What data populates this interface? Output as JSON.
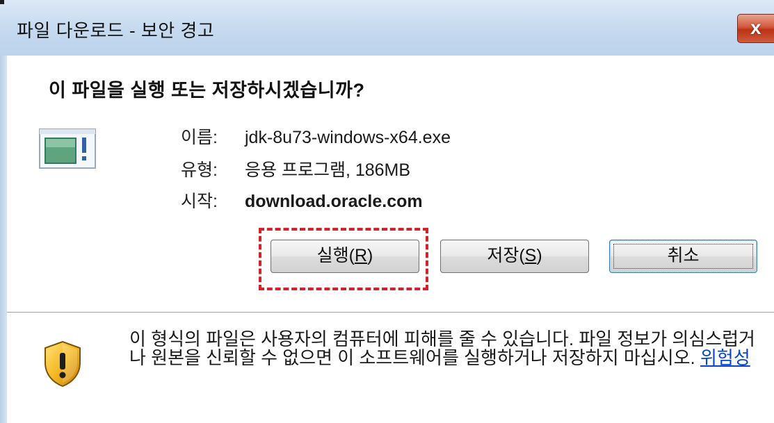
{
  "window": {
    "title": "파일 다운로드 - 보안 경고",
    "close_label": "x"
  },
  "question": "이 파일을 실행 또는 저장하시겠습니까?",
  "file_info": {
    "name_label": "이름:",
    "name_value": "jdk-8u73-windows-x64.exe",
    "type_label": "유형:",
    "type_value": "응용 프로그램, 186MB",
    "from_label": "시작:",
    "from_value": "download.oracle.com"
  },
  "buttons": {
    "run": {
      "text": "실행(",
      "mnemonic": "R",
      "suffix": ")"
    },
    "save": {
      "text": "저장(",
      "mnemonic": "S",
      "suffix": ")"
    },
    "cancel": {
      "text": "취소"
    }
  },
  "warning": {
    "text": "이 형식의 파일은 사용자의 컴퓨터에 피해를 줄 수 있습니다. 파일 정보가 의심스럽거나 원본을 신뢰할 수 없으면 이 소프트웨어를 실행하거나 저장하지 마십시오. ",
    "link": "위험성"
  },
  "colors": {
    "highlight": "#d3222a",
    "link": "#0a46c7"
  }
}
